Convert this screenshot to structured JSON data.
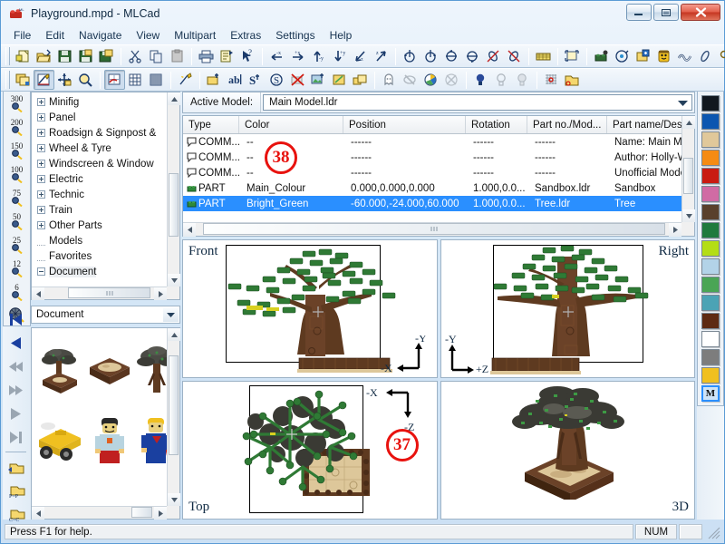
{
  "window": {
    "title": "Playground.mpd - MLCad",
    "icon": "lego-brick-icon",
    "controls": {
      "minimize": "minimize-button",
      "maximize": "maximize-button",
      "close": "close-button"
    }
  },
  "menubar": {
    "items": [
      "File",
      "Edit",
      "Navigate",
      "View",
      "Multipart",
      "Extras",
      "Settings",
      "Help"
    ]
  },
  "toolbar_row1": {
    "groups": [
      [
        "new-file-icon",
        "open-folder-icon",
        "save-disk-icon",
        "save-as-icon",
        "save-all-icon"
      ],
      [
        "cut-scissors-icon",
        "copy-icon",
        "paste-icon"
      ],
      [
        "print-icon",
        "print-preview-icon",
        "help-pointer-icon"
      ],
      [
        "move-left-x-icon",
        "move-right-x-icon",
        "move-up-y-icon",
        "move-down-y-icon",
        "move-front-z-icon",
        "move-back-z-icon"
      ],
      [
        "rotate-x-ccw-icon",
        "rotate-x-cw-icon",
        "rotate-y-ccw-icon",
        "rotate-y-cw-icon",
        "rotate-z-ccw-icon",
        "rotate-z-cw-icon"
      ],
      [
        "grid-snap-icon"
      ],
      [
        "fit-to-window-icon"
      ],
      [
        "place-part-icon",
        "rotation-point-icon",
        "add-model-icon",
        "minifig-wizard-icon",
        "flexible-hose-icon",
        "flex-axle-icon",
        "connection-icon"
      ]
    ]
  },
  "toolbar_row2": {
    "groups": [
      [
        "duplicate-model-icon",
        "edit-model-icon",
        "move-model-icon",
        "zoom-tool-icon"
      ],
      [
        "grid-toggle-icon",
        "grid-coarse-icon",
        "grid-fine-icon"
      ],
      [
        "snap-to-grid-icon"
      ],
      [
        "add-part-icon",
        "add-text-icon",
        "add-step-icon",
        "add-sub-model-icon",
        "delete-part-icon",
        "add-image-icon",
        "add-rotation-icon",
        "add-group-icon"
      ],
      [
        "ghost-part-icon",
        "hide-part-icon",
        "color-part-icon",
        "uncolor-part-icon"
      ],
      [
        "light-on-icon",
        "light-dim-icon",
        "light-off-icon"
      ],
      [
        "grid-point-icon",
        "open-buffer-icon"
      ]
    ]
  },
  "zoom_toolbar": {
    "name": "zoom-level-toolbar",
    "levels": [
      "300",
      "200",
      "150",
      "100",
      "75",
      "50",
      "25",
      "12",
      "6"
    ],
    "fit_icon": "zoom-to-fit-icon"
  },
  "tree": {
    "name": "parts-category-tree",
    "items": [
      {
        "label": "Minifig",
        "expander": "plus"
      },
      {
        "label": "Panel",
        "expander": "plus"
      },
      {
        "label": "Roadsign & Signpost &",
        "expander": "plus"
      },
      {
        "label": "Wheel & Tyre",
        "expander": "plus"
      },
      {
        "label": "Windscreen & Window",
        "expander": "plus"
      },
      {
        "label": "Electric",
        "expander": "plus"
      },
      {
        "label": "Technic",
        "expander": "plus"
      },
      {
        "label": "Train",
        "expander": "plus"
      },
      {
        "label": "Other Parts",
        "expander": "plus"
      },
      {
        "label": "Models",
        "expander": "none"
      },
      {
        "label": "Favorites",
        "expander": "none"
      },
      {
        "label": "Document",
        "expander": "minus",
        "selected": true
      }
    ]
  },
  "document_panel": {
    "combo_value": "Document",
    "combo_name": "document-selector",
    "nav_buttons": [
      "first-step-icon",
      "previous-step-icon",
      "fast-rewind-icon",
      "fast-forward-icon",
      "play-icon",
      "last-step-icon",
      "add-to-document-icon",
      "paste-part-icon",
      "copy-part-icon"
    ],
    "thumbnails": [
      {
        "name": "thumbnail-tree-sandbox"
      },
      {
        "name": "thumbnail-sandbox"
      },
      {
        "name": "thumbnail-tree"
      },
      {
        "name": "thumbnail-vehicle"
      },
      {
        "name": "thumbnail-minifig-astronaut"
      },
      {
        "name": "thumbnail-minifig-superhero"
      }
    ]
  },
  "active_model": {
    "label": "Active Model:",
    "value": "Main Model.ldr"
  },
  "parts_list": {
    "columns": [
      "Type",
      "Color",
      "Position",
      "Rotation",
      "Part no./Mod...",
      "Part name/Desc"
    ],
    "rows": [
      {
        "icon": "comment-icon",
        "type": "COMM...",
        "color": "--",
        "position": "------",
        "rotation": "------",
        "partno": "------",
        "partname": "Name: Main Moc",
        "selected": false
      },
      {
        "icon": "comment-icon",
        "type": "COMM...",
        "color": "--",
        "position": "------",
        "rotation": "------",
        "partno": "------",
        "partname": "Author: Holly-Wo",
        "selected": false
      },
      {
        "icon": "comment-icon",
        "type": "COMM...",
        "color": "--",
        "position": "------",
        "rotation": "------",
        "partno": "------",
        "partname": "Unofficial Model",
        "selected": false
      },
      {
        "icon": "part-icon",
        "type": "PART",
        "color": "Main_Colour",
        "position": "0.000,0.000,0.000",
        "rotation": "1.000,0.0...",
        "partno": "Sandbox.ldr",
        "partname": "Sandbox",
        "selected": false
      },
      {
        "icon": "part-icon",
        "type": "PART",
        "color": "Bright_Green",
        "position": "-60.000,-24.000,60.000",
        "rotation": "1.000,0.0...",
        "partno": "Tree.ldr",
        "partname": "Tree",
        "selected": true
      }
    ]
  },
  "viewports": [
    {
      "name": "viewport-front",
      "label": "Front",
      "label_pos": "top-left",
      "axes": [
        "-Y",
        "-X"
      ],
      "axis_pos": "bottom-right",
      "marker": null
    },
    {
      "name": "viewport-right",
      "label": "Right",
      "label_pos": "top-right",
      "axes": [
        "-Y",
        "+Z"
      ],
      "axis_pos": "bottom-left",
      "marker": null
    },
    {
      "name": "viewport-top",
      "label": "Top",
      "label_pos": "bottom-left",
      "axes": [
        "-X",
        "-Z"
      ],
      "axis_pos": "top-right",
      "marker": "37"
    },
    {
      "name": "viewport-3d",
      "label": "3D",
      "label_pos": "bottom-right",
      "axes": [],
      "axis_pos": "",
      "marker": null
    }
  ],
  "annotations": [
    {
      "id": "38",
      "target": "parts-list"
    },
    {
      "id": "37",
      "target": "viewport-top"
    }
  ],
  "palette": {
    "name": "color-palette",
    "colors": [
      {
        "hex": "#11181f",
        "name": "black"
      },
      {
        "hex": "#0b56b0",
        "name": "blue"
      },
      {
        "hex": "#e0c89a",
        "name": "tan"
      },
      {
        "hex": "#f58b13",
        "name": "orange"
      },
      {
        "hex": "#c91b12",
        "name": "red"
      },
      {
        "hex": "#d06ba4",
        "name": "pink"
      },
      {
        "hex": "#59402c",
        "name": "dark-brown"
      },
      {
        "hex": "#1f7a3d",
        "name": "green"
      },
      {
        "hex": "#b4dd16",
        "name": "lime"
      },
      {
        "hex": "#b3d3e8",
        "name": "light-blue"
      },
      {
        "hex": "#4aa555",
        "name": "bright-green"
      },
      {
        "hex": "#4ba3b5",
        "name": "teal"
      },
      {
        "hex": "#5e2a12",
        "name": "reddish-brown"
      },
      {
        "hex": "#ffffff",
        "name": "white"
      },
      {
        "hex": "#7d7d7d",
        "name": "grey"
      },
      {
        "hex": "#f0c020",
        "name": "yellow"
      }
    ],
    "main_colour_swatch": {
      "label": "M",
      "name": "main-colour-swatch",
      "selected": true
    }
  },
  "statusbar": {
    "message": "Press F1 for help.",
    "num_indicator": "NUM"
  }
}
